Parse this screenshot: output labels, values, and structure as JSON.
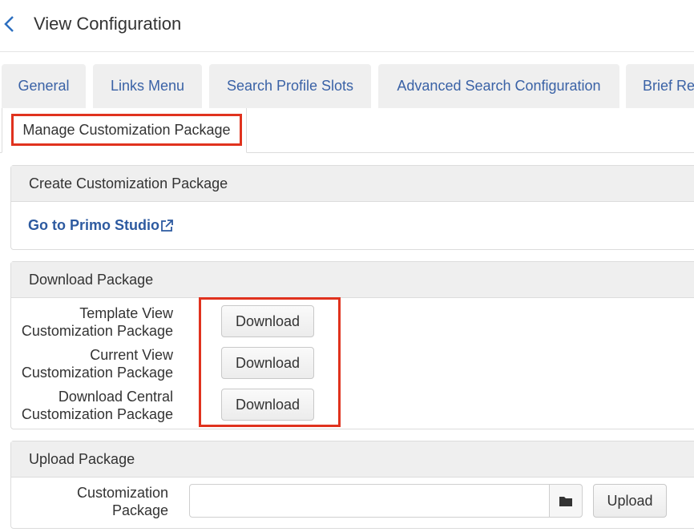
{
  "header": {
    "title": "View Configuration"
  },
  "tabs": [
    {
      "label": "General"
    },
    {
      "label": "Links Menu"
    },
    {
      "label": "Search Profile Slots"
    },
    {
      "label": "Advanced Search Configuration"
    },
    {
      "label": "Brief Re"
    }
  ],
  "active_tab": {
    "label": "Manage Customization Package"
  },
  "create_section": {
    "title": "Create Customization Package",
    "link_label": "Go to Primo Studio",
    "link_icon": "external-link-icon"
  },
  "download_section": {
    "title": "Download Package",
    "rows": [
      {
        "label_line1": "Template View",
        "label_line2": "Customization Package",
        "button": "Download"
      },
      {
        "label_line1": "Current View",
        "label_line2": "Customization Package",
        "button": "Download"
      },
      {
        "label_line1": "Download Central",
        "label_line2": "Customization Package",
        "button": "Download"
      }
    ]
  },
  "upload_section": {
    "title": "Upload Package",
    "label_line1": "Customization",
    "label_line2": "Package",
    "file_value": "",
    "browse_icon": "folder-icon",
    "upload_button": "Upload"
  },
  "colors": {
    "link": "#2d5aa0",
    "tab_text": "#3a62a6",
    "highlight": "#e0321e",
    "panel_header": "#efefef"
  }
}
